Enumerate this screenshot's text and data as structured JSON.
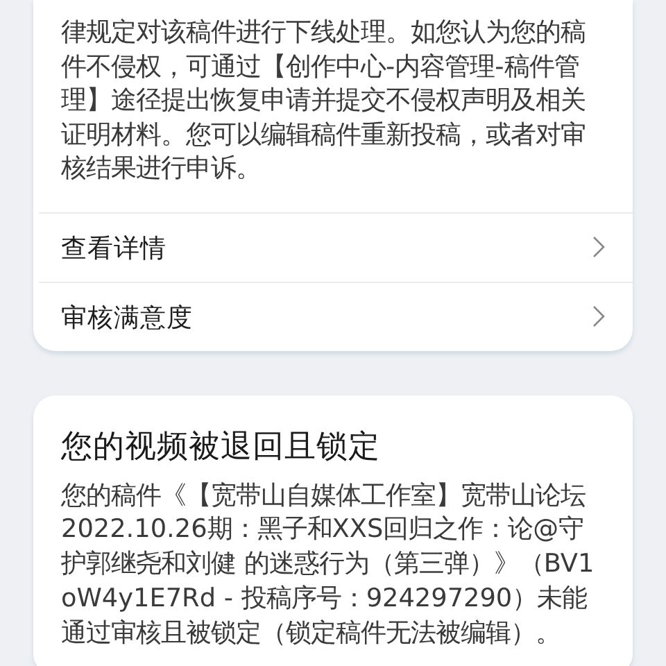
{
  "cards": [
    {
      "body": "律规定对该稿件进行下线处理。如您认为您的稿件不侵权，可通过【创作中心-内容管理-稿件管理】途径提出恢复申请并提交不侵权声明及相关证明材料。您可以编辑稿件重新投稿，或者对审核结果进行申诉。",
      "links": [
        {
          "label": "查看详情"
        },
        {
          "label": "审核满意度"
        }
      ]
    },
    {
      "title": "您的视频被退回且锁定",
      "body": "您的稿件《【宽带山自媒体工作室】宽带山论坛 2022.10.26期：黑子和XXS回归之作：论@守护郭继尧和刘健 的迷惑行为（第三弹）》（BV1oW4y1E7Rd - 投稿序号：924297290）未能通过审核且被锁定（锁定稿件无法被编辑）。"
    }
  ]
}
